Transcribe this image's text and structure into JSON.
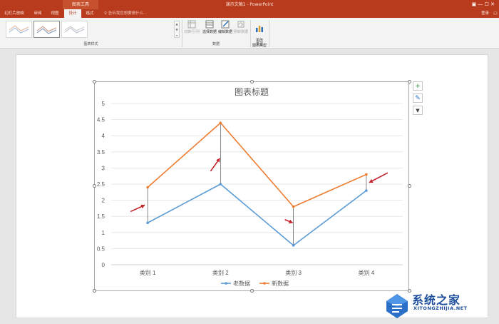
{
  "window": {
    "context_tab": "图表工具",
    "title": "演示文稿1 - PowerPoint",
    "controls": "▣ — ☐ ✕"
  },
  "tabs": [
    {
      "label": "幻灯片放映"
    },
    {
      "label": "审阅"
    },
    {
      "label": "视图"
    },
    {
      "label": "设计"
    },
    {
      "label": "格式"
    }
  ],
  "tellme": "♀ 告诉我您想要做什么...",
  "login": "登录",
  "ribbon": {
    "group_styles": "图表样式",
    "group_data": "数据",
    "group_type": "类型",
    "buttons": {
      "switch": "切换行/列",
      "select": "选择数据",
      "edit": "编辑数据",
      "refresh": "刷新数据",
      "change_type": "更改\n图表类型"
    }
  },
  "chart_data": {
    "type": "line",
    "title": "图表标题",
    "categories": [
      "类别 1",
      "类别 2",
      "类别 3",
      "类别 4"
    ],
    "series": [
      {
        "name": "老数据",
        "values": [
          1.3,
          2.5,
          0.6,
          2.3
        ],
        "color": "#5b9bd5"
      },
      {
        "name": "新数据",
        "values": [
          2.4,
          4.4,
          1.8,
          2.8
        ],
        "color": "#ed7d31"
      }
    ],
    "ylim": [
      0,
      5
    ],
    "yticks": [
      "0",
      "0.5",
      "1",
      "1.5",
      "2",
      "2.5",
      "3",
      "3.5",
      "4",
      "4.5",
      "5"
    ],
    "grid": true,
    "legend": "bottom",
    "drop_lines": true,
    "arrow_color": "#c0232b"
  },
  "side_buttons": [
    "+",
    "✎",
    "▼"
  ],
  "watermark": {
    "name": "系统之家",
    "url": "XITONGZHIJIA.NET"
  }
}
